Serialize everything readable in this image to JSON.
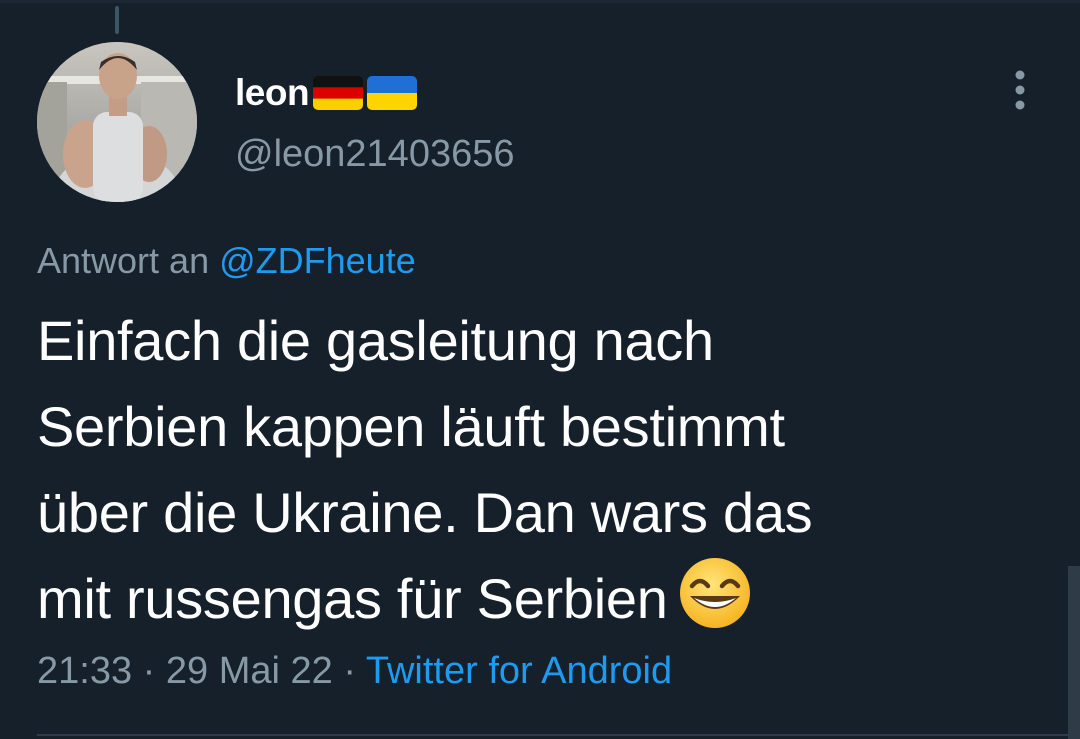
{
  "tweet": {
    "display_name": "leon",
    "handle": "@leon21403656",
    "flags": [
      "germany-flag",
      "ukraine-flag"
    ],
    "reply_prefix": "Antwort an",
    "reply_mention": "@ZDFheute",
    "text_lines": [
      "Einfach die gasleitung nach",
      "Serbien kappen läuft bestimmt",
      "über die Ukraine. Dan wars das",
      "mit russengas für Serbien"
    ],
    "emoji": "grinning-face-with-smiling-eyes",
    "time": "21:33",
    "separator": "·",
    "date": "29 Mai 22",
    "source": "Twitter for Android"
  },
  "icons": {
    "more": "more-vertical-icon"
  },
  "colors": {
    "background": "#15202b",
    "secondary_text": "#8899a6",
    "link": "#1d9bf0"
  }
}
